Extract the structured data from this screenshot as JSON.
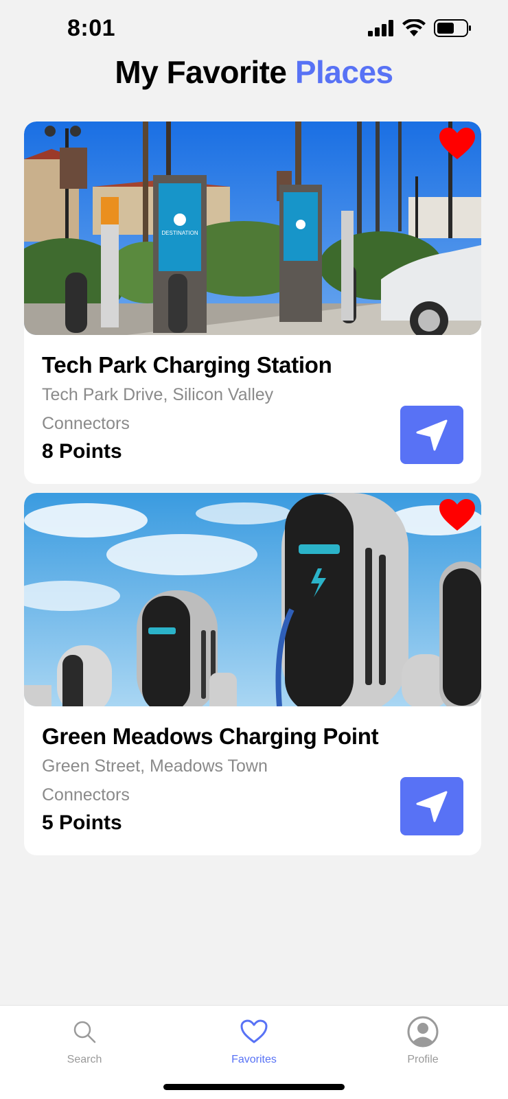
{
  "status_bar": {
    "time": "8:01"
  },
  "header": {
    "title_main": "My Favorite",
    "title_accent": "Places"
  },
  "colors": {
    "accent": "#5872f5",
    "heart": "#ff0000",
    "muted_text": "#8a8a8a"
  },
  "places": [
    {
      "name": "Tech Park Charging Station",
      "address": "Tech Park Drive, Silicon Valley",
      "connectors_label": "Connectors",
      "points": "8 Points",
      "favorite": true,
      "photo_signage": "DESTINATION"
    },
    {
      "name": "Green Meadows Charging Point",
      "address": "Green Street, Meadows Town",
      "connectors_label": "Connectors",
      "points": "5 Points",
      "favorite": true
    }
  ],
  "tab_bar": {
    "items": [
      {
        "label": "Search",
        "icon": "search-icon"
      },
      {
        "label": "Favorites",
        "icon": "heart-icon",
        "active": true
      },
      {
        "label": "Profile",
        "icon": "profile-icon"
      }
    ]
  }
}
